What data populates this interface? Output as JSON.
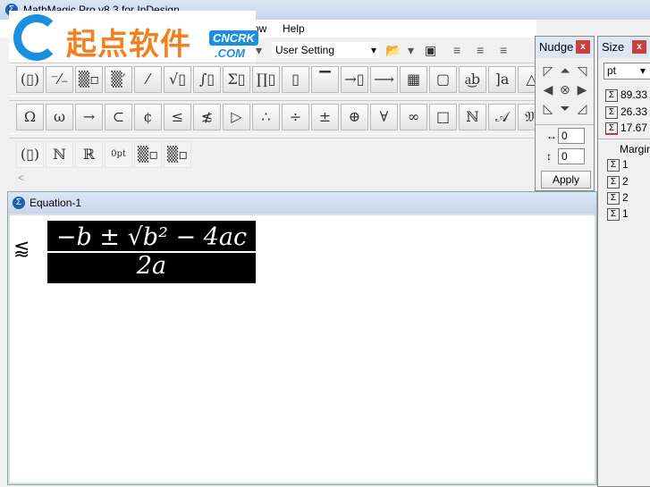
{
  "window": {
    "title": "MathMagic Pro v8.3 for InDesign"
  },
  "watermark": {
    "cn": "起点软件",
    "en1": "CNCRK",
    ".com": ".COM"
  },
  "menu": {
    "items": [
      "ow",
      "Help"
    ]
  },
  "toolbar": {
    "style_dropdown": "User Setting"
  },
  "palette": {
    "row1": [
      "(▯)",
      "⁻⁄₋",
      "▒▫",
      "▒′",
      "⁄",
      "√▯",
      "∫▯",
      "Σ▯",
      "∏▯",
      "▯",
      "▔",
      "→▯",
      "⟶",
      "▦",
      "▢",
      "a͜b",
      "]a",
      "△"
    ],
    "row2": [
      "Ω",
      "ω",
      "→",
      "⊂",
      "¢",
      "≤",
      "≴",
      "▷",
      "∴",
      "÷",
      "±",
      "⊕",
      "∀",
      "∞",
      "□",
      "ℕ",
      "𝒜",
      "𝔐"
    ],
    "row3": [
      "(▯)",
      "ℕ",
      "ℝ",
      "0pt",
      "▒▫",
      "▒▫"
    ],
    "scroll_left": "<"
  },
  "equation_window": {
    "title": "Equation-1",
    "side_symbol": "⪅",
    "numerator": "−b ± √b² − 4ac",
    "denominator": "2a"
  },
  "nudge": {
    "title": "Nudge",
    "close": "x",
    "arrows": [
      "◸",
      "⏶",
      "◹",
      "◀",
      "⊗",
      "▶",
      "◺",
      "⏷",
      "◿"
    ],
    "h_value": "0",
    "v_value": "0",
    "h_icon": "↔",
    "v_icon": "↕",
    "apply": "Apply"
  },
  "size": {
    "title": "Size",
    "close": "x",
    "unit": "pt",
    "width": "89.33",
    "height": "26.33",
    "depth": "17.67",
    "margin_label": "Margin",
    "margins": [
      "1",
      "2",
      "2",
      "1"
    ]
  }
}
